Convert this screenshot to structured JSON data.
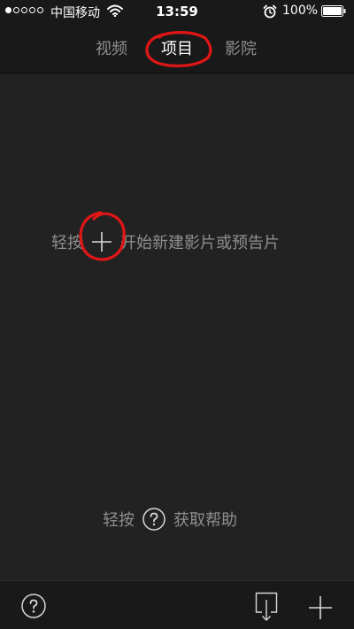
{
  "status_bar": {
    "signal_bars_filled": 1,
    "signal_bars_total": 5,
    "carrier": "中国移动",
    "time": "13:59",
    "battery_percent": "100%",
    "icons": [
      "wifi-icon",
      "alarm-icon",
      "battery-icon"
    ]
  },
  "nav": {
    "tabs": [
      {
        "label": "视频",
        "active": false
      },
      {
        "label": "项目",
        "active": true
      },
      {
        "label": "影院",
        "active": false
      }
    ]
  },
  "main": {
    "new_hint": {
      "prefix": "轻按",
      "icon": "plus-icon",
      "suffix": "开始新建影片或预告片"
    },
    "help_hint": {
      "prefix": "轻按",
      "icon": "help-icon",
      "suffix": "获取帮助"
    }
  },
  "toolbar": {
    "buttons": [
      "help-icon",
      "import-icon",
      "plus-icon"
    ]
  },
  "colors": {
    "background": "#222222",
    "bar_background": "#191919",
    "text_primary": "#ffffff",
    "text_secondary": "#8e8e8e",
    "annotation": "#e01616"
  }
}
